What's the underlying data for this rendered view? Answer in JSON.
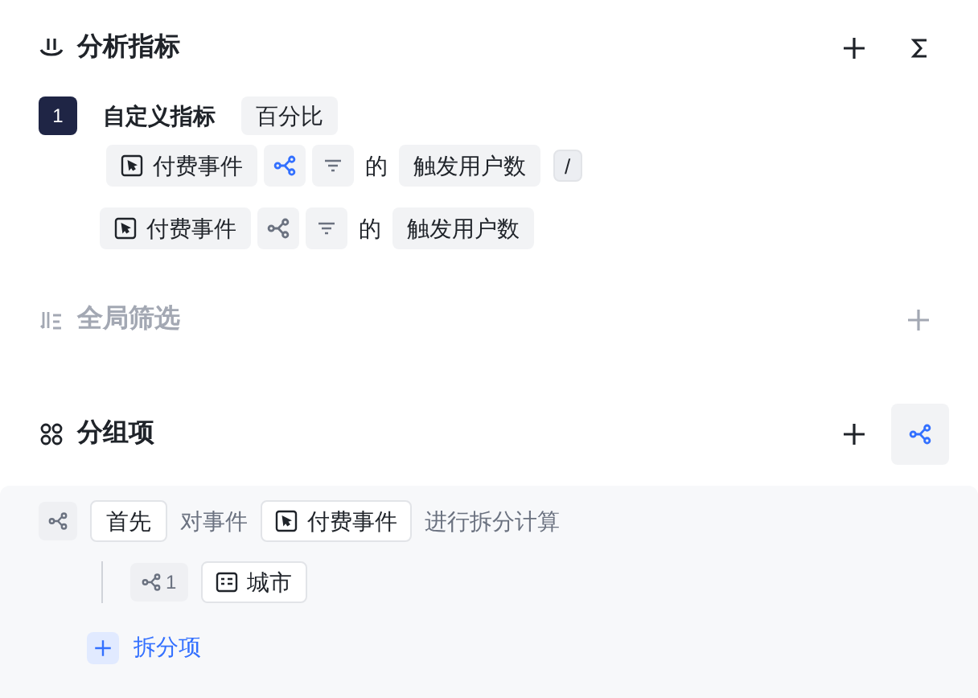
{
  "metrics": {
    "title": "分析指标",
    "items": [
      {
        "index": "1",
        "name": "自定义指标",
        "format": "百分比",
        "terms": [
          {
            "event": "付费事件",
            "split_on": true,
            "of": "的",
            "measure": "触发用户数",
            "operator": "/"
          },
          {
            "event": "付费事件",
            "split_on": false,
            "of": "的",
            "measure": "触发用户数"
          }
        ]
      }
    ]
  },
  "global_filter": {
    "title": "全局筛选",
    "disabled": true
  },
  "grouping": {
    "title": "分组项",
    "split_mode_on": true,
    "split": {
      "order": "首先",
      "prefix": "对事件",
      "event": "付费事件",
      "suffix": "进行拆分计算",
      "items": [
        {
          "index": "1",
          "field": "城市"
        }
      ],
      "add_label": "拆分项"
    }
  }
}
